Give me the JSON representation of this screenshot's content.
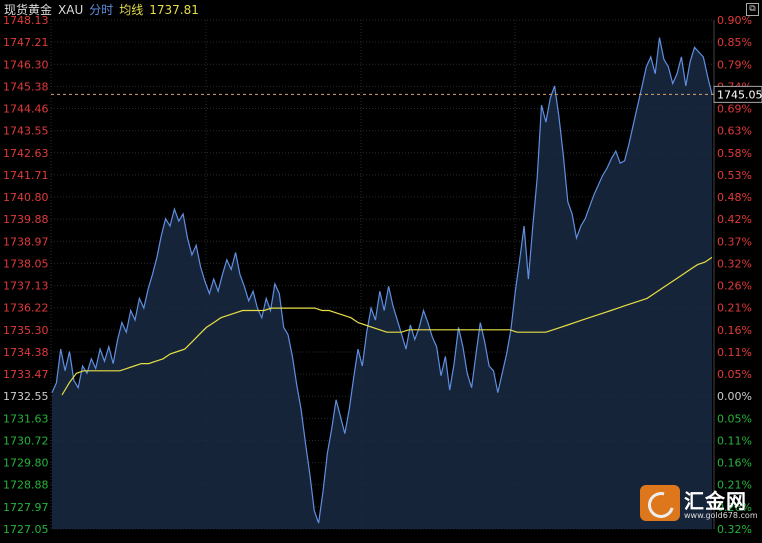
{
  "header": {
    "instrument": "现货黄金",
    "symbol": "XAU",
    "mode": "分时",
    "ma_label": "均线",
    "ma_value": "1737.81"
  },
  "colors": {
    "background": "#000000",
    "grid": "#2a2a2a",
    "price_line": "#5f8fe0",
    "area_fill": "#1a2a44",
    "ma_line": "#e6de45",
    "up": "#e03a3a",
    "down": "#27b33c",
    "neutral": "#cccccc",
    "ref_line": "#d9a070"
  },
  "watermark": {
    "brand": "汇金网",
    "url": "www.gold678.com"
  },
  "chart_data": {
    "type": "line",
    "xlabel": "",
    "ylabel": "",
    "ylim": [
      1727.05,
      1748.13
    ],
    "left_ticks": [
      "1748.13",
      "1747.21",
      "1746.30",
      "1745.38",
      "1744.46",
      "1743.55",
      "1742.63",
      "1741.71",
      "1740.80",
      "1739.88",
      "1738.97",
      "1738.05",
      "1737.13",
      "1736.22",
      "1735.30",
      "1734.38",
      "1733.47",
      "1732.55",
      "1731.63",
      "1730.72",
      "1729.80",
      "1728.88",
      "1727.97",
      "1727.05"
    ],
    "right_ticks": [
      "0.90%",
      "0.85%",
      "0.79%",
      "0.74%",
      "0.69%",
      "0.63%",
      "0.58%",
      "0.53%",
      "0.48%",
      "0.42%",
      "0.37%",
      "0.32%",
      "0.26%",
      "0.21%",
      "0.16%",
      "0.11%",
      "0.05%",
      "0.00%",
      "0.05%",
      "0.11%",
      "0.16%",
      "0.21%",
      "0.26%",
      "0.32%"
    ],
    "reference_price": "1745.05",
    "series": [
      {
        "name": "price",
        "values": [
          1732.7,
          1733.1,
          1734.5,
          1733.6,
          1734.4,
          1733.2,
          1732.9,
          1733.8,
          1733.5,
          1734.1,
          1733.7,
          1734.5,
          1734.0,
          1734.6,
          1733.9,
          1734.9,
          1735.6,
          1735.2,
          1736.1,
          1735.7,
          1736.6,
          1736.2,
          1737.0,
          1737.6,
          1738.3,
          1739.2,
          1739.9,
          1739.6,
          1740.3,
          1739.8,
          1740.1,
          1739.1,
          1738.4,
          1738.8,
          1737.9,
          1737.3,
          1736.8,
          1737.4,
          1736.9,
          1737.6,
          1738.2,
          1737.8,
          1738.5,
          1737.6,
          1737.1,
          1736.5,
          1736.9,
          1736.2,
          1735.8,
          1736.6,
          1736.1,
          1737.2,
          1736.8,
          1735.4,
          1735.1,
          1734.2,
          1733.0,
          1732.0,
          1730.6,
          1729.3,
          1727.8,
          1727.3,
          1728.6,
          1730.2,
          1731.2,
          1732.4,
          1731.7,
          1731.0,
          1732.0,
          1733.3,
          1734.5,
          1733.8,
          1735.2,
          1736.2,
          1735.7,
          1736.9,
          1736.1,
          1737.1,
          1736.3,
          1735.7,
          1735.1,
          1734.5,
          1735.5,
          1734.9,
          1735.4,
          1736.1,
          1735.6,
          1735.0,
          1734.6,
          1733.4,
          1734.2,
          1732.8,
          1733.9,
          1735.4,
          1734.6,
          1733.5,
          1732.9,
          1734.3,
          1735.6,
          1734.8,
          1733.8,
          1733.6,
          1732.7,
          1733.5,
          1734.3,
          1735.3,
          1736.9,
          1738.2,
          1739.6,
          1737.4,
          1739.6,
          1741.6,
          1744.6,
          1743.9,
          1744.9,
          1745.4,
          1744.1,
          1742.5,
          1740.6,
          1740.1,
          1739.1,
          1739.6,
          1739.9,
          1740.4,
          1740.9,
          1741.3,
          1741.7,
          1742.0,
          1742.4,
          1742.7,
          1742.2,
          1742.3,
          1743.0,
          1743.8,
          1744.6,
          1745.4,
          1746.2,
          1746.6,
          1745.9,
          1747.4,
          1746.5,
          1746.2,
          1745.5,
          1745.9,
          1746.6,
          1745.4,
          1746.4,
          1747.0,
          1746.8,
          1746.6,
          1745.8,
          1745.05
        ]
      },
      {
        "name": "ma",
        "values": [
          1732.6,
          1733.1,
          1733.5,
          1733.6,
          1733.6,
          1733.6,
          1733.6,
          1733.6,
          1733.6,
          1733.7,
          1733.8,
          1733.9,
          1733.9,
          1734.0,
          1734.1,
          1734.3,
          1734.4,
          1734.5,
          1734.8,
          1735.1,
          1735.4,
          1735.6,
          1735.8,
          1735.9,
          1736.0,
          1736.1,
          1736.1,
          1736.1,
          1736.1,
          1736.2,
          1736.2,
          1736.2,
          1736.2,
          1736.2,
          1736.2,
          1736.2,
          1736.1,
          1736.1,
          1736.0,
          1735.9,
          1735.8,
          1735.6,
          1735.5,
          1735.4,
          1735.3,
          1735.2,
          1735.2,
          1735.2,
          1735.3,
          1735.3,
          1735.3,
          1735.3,
          1735.3,
          1735.3,
          1735.3,
          1735.3,
          1735.3,
          1735.3,
          1735.3,
          1735.3,
          1735.3,
          1735.3,
          1735.3,
          1735.2,
          1735.2,
          1735.2,
          1735.2,
          1735.2,
          1735.3,
          1735.4,
          1735.5,
          1735.6,
          1735.7,
          1735.8,
          1735.9,
          1736.0,
          1736.1,
          1736.2,
          1736.3,
          1736.4,
          1736.5,
          1736.6,
          1736.8,
          1737.0,
          1737.2,
          1737.4,
          1737.6,
          1737.8,
          1738.0,
          1738.1,
          1738.3
        ]
      }
    ]
  }
}
